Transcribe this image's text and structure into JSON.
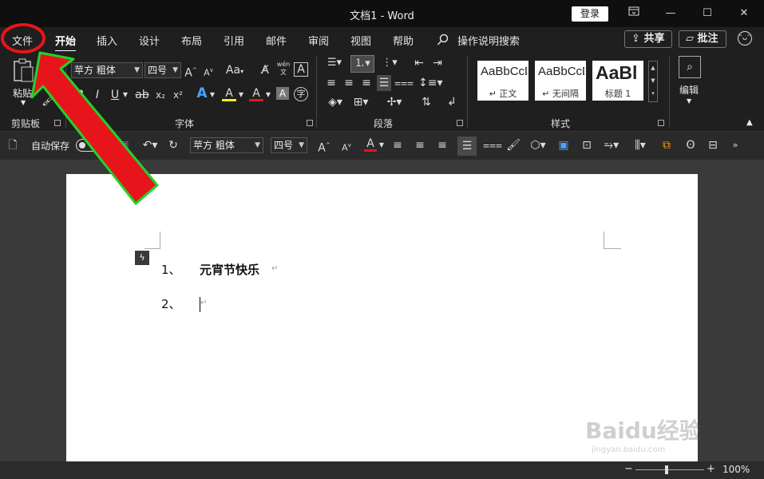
{
  "window": {
    "title": "文档1 - Word",
    "login_label": "登录",
    "minimize": "—",
    "maximize": "☐",
    "close": "✕",
    "restore_icon": "▭"
  },
  "tabs": [
    "文件",
    "开始",
    "插入",
    "设计",
    "布局",
    "引用",
    "邮件",
    "审阅",
    "视图",
    "帮助"
  ],
  "search": {
    "label": "操作说明搜索"
  },
  "header_buttons": {
    "share": "共享",
    "comment": "批注"
  },
  "ribbon": {
    "clipboard": {
      "paste_label": "粘贴",
      "group_label": "剪贴板"
    },
    "font": {
      "font_name": "苹方 粗体",
      "font_size": "四号",
      "group_label": "字体",
      "aa": "Aa",
      "phonetic": "wén",
      "bold": "B",
      "italic": "I",
      "underline": "U",
      "strike": "ab",
      "sub": "x₂",
      "sup": "x²",
      "font_color_letter": "A",
      "highlight_letter": "A",
      "grow": "A",
      "shrink": "A"
    },
    "paragraph": {
      "group_label": "段落"
    },
    "styles": {
      "group_label": "样式",
      "cards": [
        {
          "preview": "AaBbCcDc",
          "caption": "↵ 正文"
        },
        {
          "preview": "AaBbCcDc",
          "caption": "↵ 无间隔"
        },
        {
          "preview": "AaBl",
          "caption": "标题 1"
        }
      ]
    },
    "editing": {
      "label": "编辑"
    }
  },
  "qat": {
    "autosave_label": "自动保存",
    "autosave_state": "关",
    "font_name": "苹方 粗体",
    "font_size": "四号"
  },
  "document": {
    "list_items": [
      {
        "number": "1、",
        "text": "元宵节快乐"
      },
      {
        "number": "2、",
        "text": ""
      }
    ]
  },
  "statusbar": {
    "zoom": "100%",
    "minus": "−",
    "plus": "+"
  },
  "watermark": {
    "text": "Baidu经验",
    "url": "jingyan.baidu.com"
  },
  "colors": {
    "annotation_red": "#e8141b",
    "annotation_green": "#22d22a",
    "accent_red": "#e81123"
  }
}
